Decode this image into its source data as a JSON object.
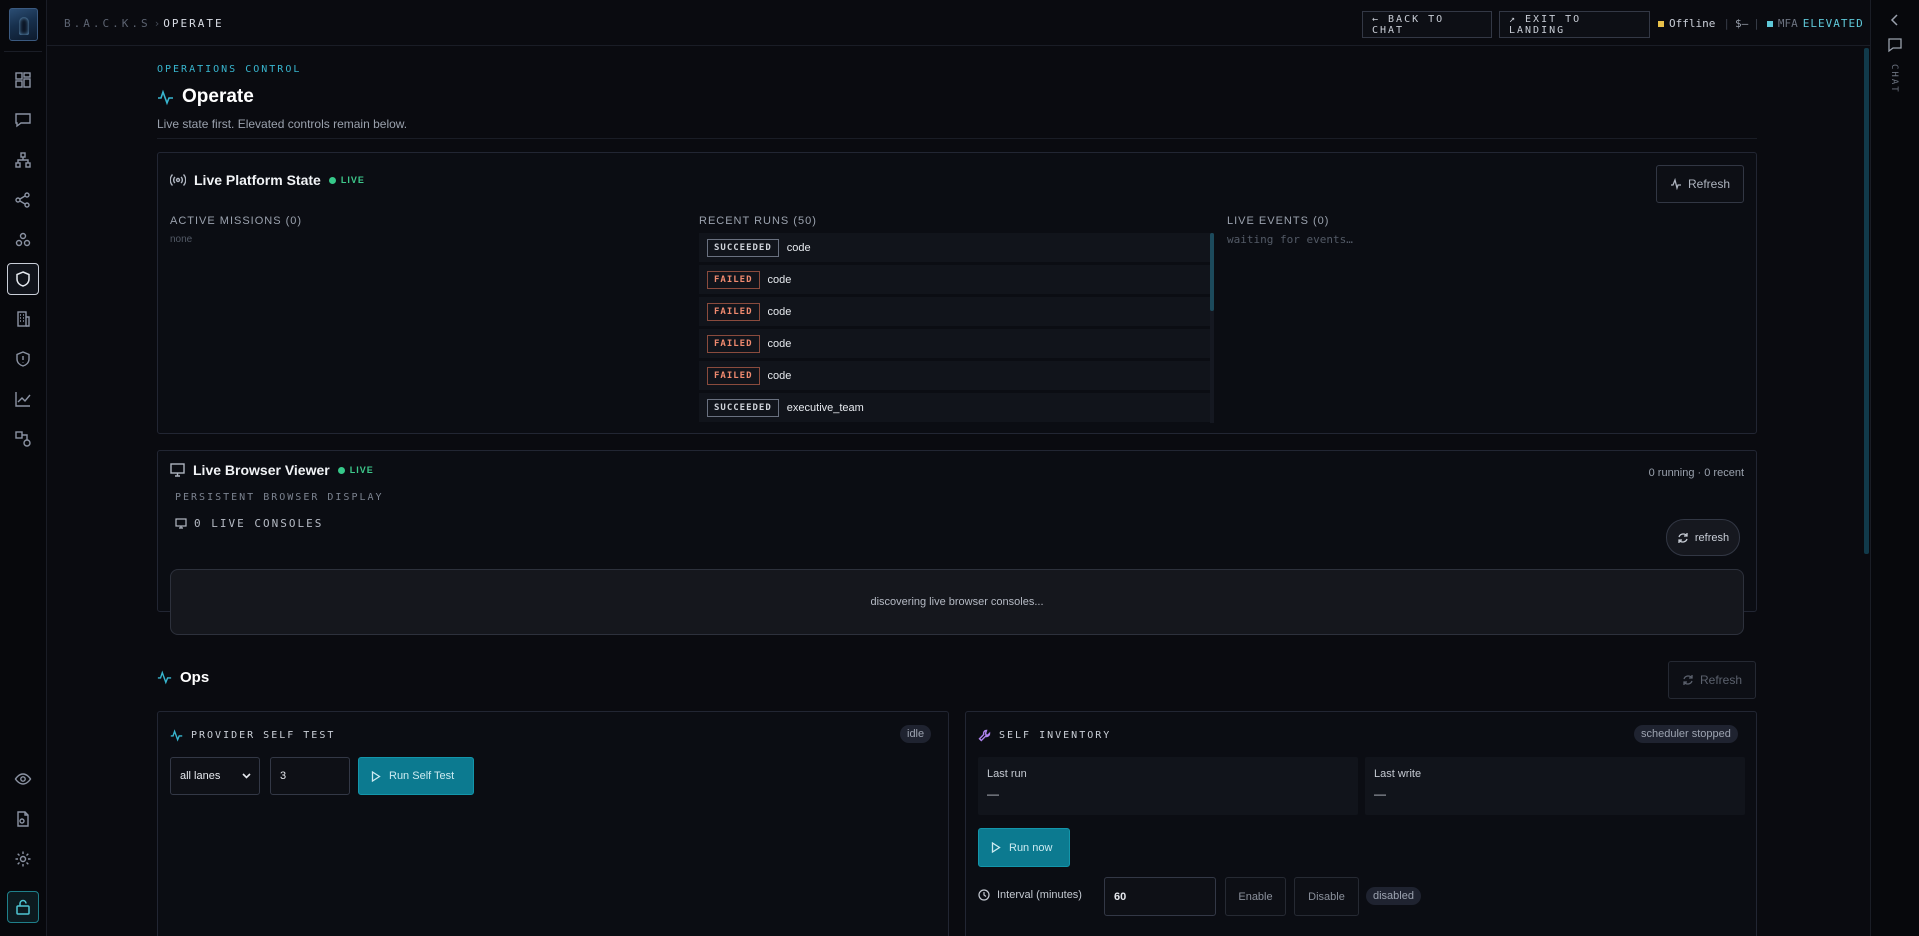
{
  "app": {
    "name": "B.A.C.K.S",
    "current_page": "OPERATE"
  },
  "topbar": {
    "back_to_chat": "← BACK TO CHAT",
    "exit_to_landing": "↗ EXIT TO LANDING",
    "connection_status": "Offline",
    "cost": "$—",
    "mfa_label": "MFA",
    "mfa_state": "ELEVATED"
  },
  "rail": {
    "items": [
      "dashboard-icon",
      "chat-icon",
      "hierarchy-icon",
      "share-icon",
      "agents-icon",
      "shield-icon",
      "building-icon",
      "shield-alert-icon",
      "chart-icon",
      "workflow-icon"
    ],
    "bottom": [
      "eye-icon",
      "file-icon",
      "settings-icon",
      "unlock-icon"
    ]
  },
  "right_rail": {
    "label": "CHAT"
  },
  "header": {
    "eyebrow": "OPERATIONS CONTROL",
    "title": "Operate",
    "subtitle": "Live state first. Elevated controls remain below."
  },
  "platform_state": {
    "title": "Live Platform State",
    "live_label": "LIVE",
    "refresh_label": "Refresh",
    "missions_header": "ACTIVE MISSIONS (0)",
    "missions_empty": "none",
    "runs_header": "RECENT RUNS (50)",
    "runs": [
      {
        "status": "SUCCEEDED",
        "name": "code"
      },
      {
        "status": "FAILED",
        "name": "code"
      },
      {
        "status": "FAILED",
        "name": "code"
      },
      {
        "status": "FAILED",
        "name": "code"
      },
      {
        "status": "FAILED",
        "name": "code"
      },
      {
        "status": "SUCCEEDED",
        "name": "executive_team"
      }
    ],
    "events_header": "LIVE EVENTS (0)",
    "events_empty": "waiting for events…"
  },
  "browser_viewer": {
    "title": "Live Browser Viewer",
    "live_label": "LIVE",
    "counts": "0 running · 0 recent",
    "caption": "PERSISTENT BROWSER DISPLAY",
    "consoles_label": "0 LIVE CONSOLES",
    "refresh_label": "refresh",
    "placeholder": "discovering live browser consoles..."
  },
  "ops": {
    "title": "Ops",
    "refresh_label": "Refresh",
    "self_test": {
      "title": "PROVIDER SELF TEST",
      "status": "idle",
      "lane_select": "all lanes",
      "count_value": "3",
      "run_label": "Run Self Test"
    },
    "self_inventory": {
      "title": "SELF INVENTORY",
      "status": "scheduler stopped",
      "last_run_label": "Last run",
      "last_run_value": "—",
      "last_write_label": "Last write",
      "last_write_value": "—",
      "run_now_label": "Run now",
      "interval_label": "Interval (minutes)",
      "interval_value": "60",
      "enable_label": "Enable",
      "disable_label": "Disable",
      "state": "disabled"
    }
  },
  "colors": {
    "accent": "#38b6cf",
    "live": "#36c98a",
    "failed": "#f08a6f",
    "primary_button": "#0c7a90",
    "offline": "#e8c14a"
  }
}
